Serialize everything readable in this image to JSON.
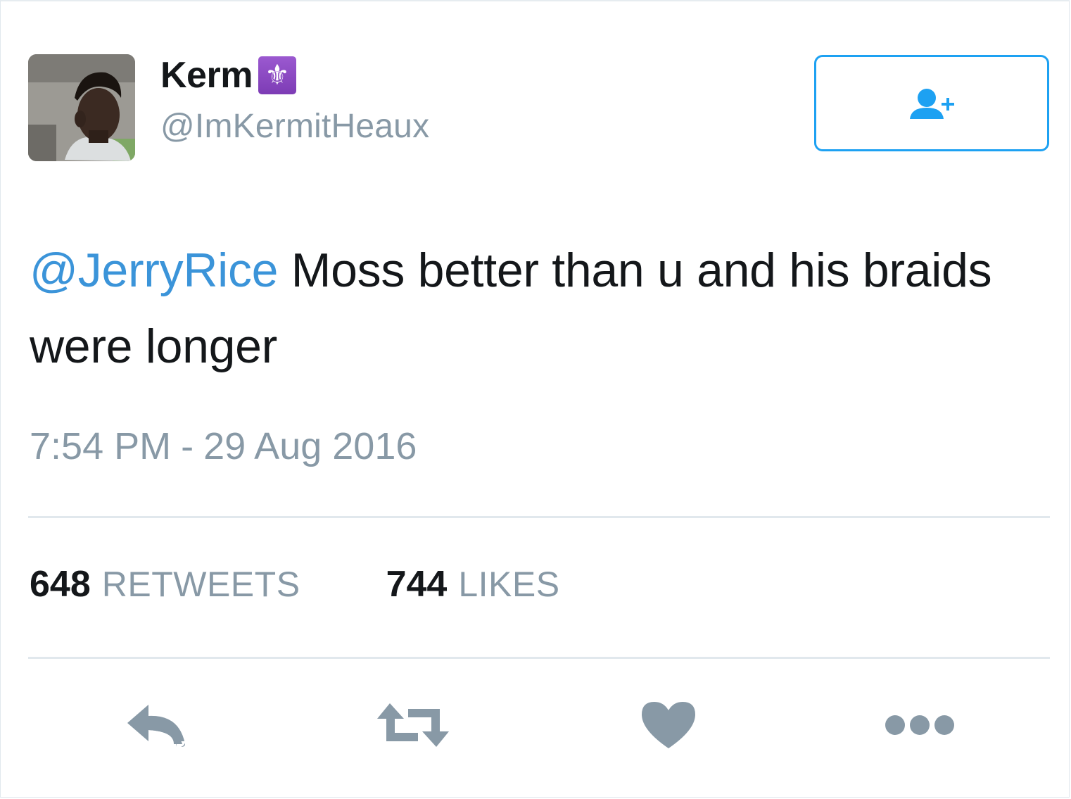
{
  "author": {
    "display_name": "Kerm",
    "badge_emoji": "⚜",
    "handle": "@ImKermitHeaux",
    "avatar_icon": "avatar-photo"
  },
  "follow_button": {
    "icon": "follow-user-plus-icon",
    "color": "#1da1f2"
  },
  "tweet": {
    "mention": "@JerryRice",
    "text": " Moss better than u and his braids were longer"
  },
  "meta": {
    "time": "7:54 PM",
    "separator": "-",
    "date": "29 Aug 2016"
  },
  "stats": {
    "retweets_count": "648",
    "retweets_label": "RETWEETS",
    "likes_count": "744",
    "likes_label": "LIKES"
  },
  "actions": {
    "reply": "reply-icon",
    "retweet": "retweet-icon",
    "like": "heart-icon",
    "more": "more-icon",
    "icon_color": "#8899a6"
  },
  "colors": {
    "link": "#3b94d9",
    "muted": "#8899a6",
    "text": "#14171a",
    "divider": "#e1e8ed",
    "badge": "#8e44ad"
  }
}
